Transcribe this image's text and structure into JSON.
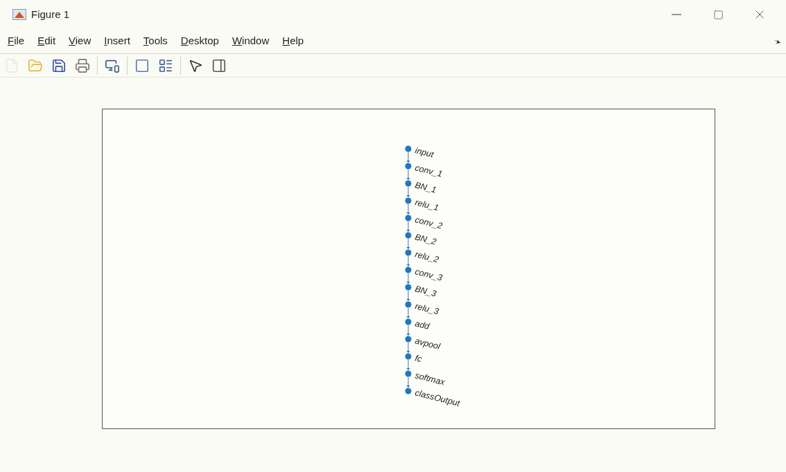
{
  "window": {
    "title": "Figure 1"
  },
  "menu": [
    "File",
    "Edit",
    "View",
    "Insert",
    "Tools",
    "Desktop",
    "Window",
    "Help"
  ],
  "graph": {
    "nodes": [
      {
        "label": "input"
      },
      {
        "label": "conv_1"
      },
      {
        "label": "BN_1"
      },
      {
        "label": "relu_1"
      },
      {
        "label": "conv_2"
      },
      {
        "label": "BN_2"
      },
      {
        "label": "relu_2"
      },
      {
        "label": "conv_3"
      },
      {
        "label": "BN_3"
      },
      {
        "label": "relu_3"
      },
      {
        "label": "add"
      },
      {
        "label": "avpool"
      },
      {
        "label": "fc"
      },
      {
        "label": "softmax"
      },
      {
        "label": "classOutput"
      }
    ]
  }
}
